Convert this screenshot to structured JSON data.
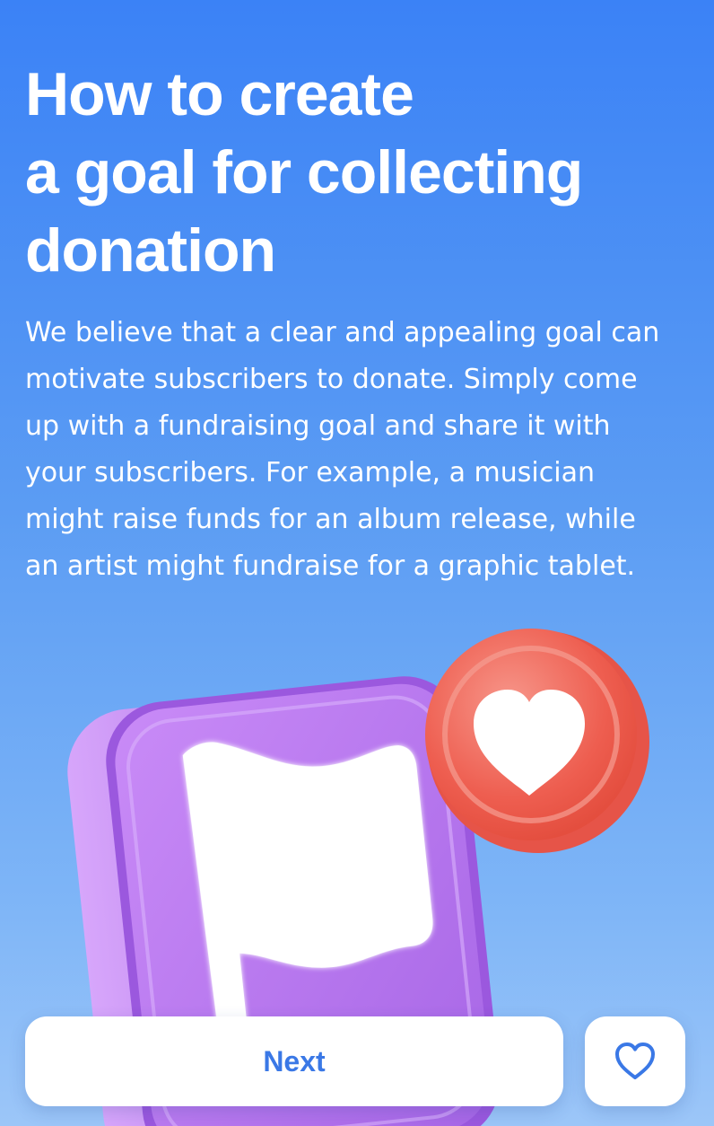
{
  "heading": {
    "line1": "How to create",
    "line2": "a goal for collecting",
    "line3": "donation"
  },
  "description": {
    "line1": "We believe that a clear and appealing goal can",
    "line2": "motivate subscribers to donate. Simply come",
    "line3": "up with a fundraising goal and share it with",
    "line4": "your subscribers. For example, a musician",
    "line5": "might raise funds for an album release, while",
    "line6": "an artist might fundraise for a graphic tablet."
  },
  "illustration": {
    "main_icon": "flag-icon",
    "badge_icon": "heart-icon",
    "tile_color": "#b77ef0",
    "badge_color": "#ef5a4c"
  },
  "actions": {
    "next_label": "Next",
    "like_icon": "heart-outline-icon"
  },
  "colors": {
    "accent": "#3a78e6",
    "background_top": "#3b82f6",
    "background_bottom": "#9cc6f8"
  }
}
